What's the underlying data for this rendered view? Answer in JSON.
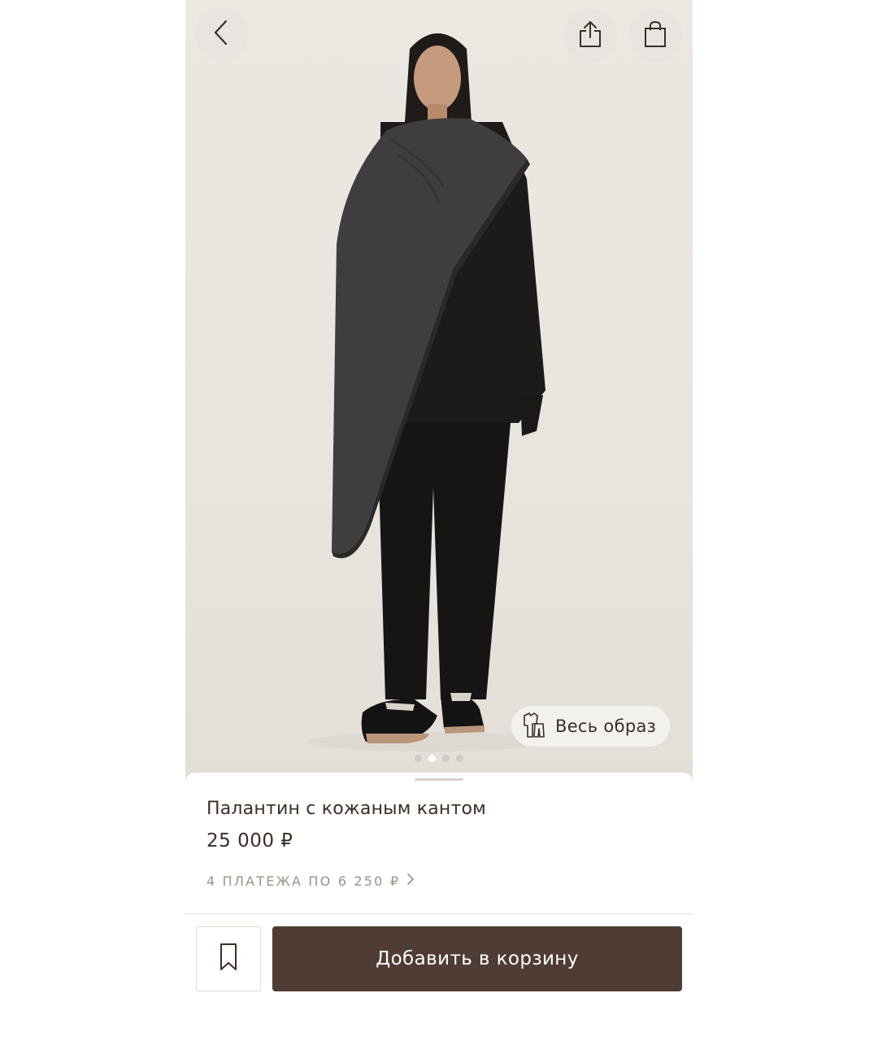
{
  "product": {
    "title": "Палантин с кожаным кантом",
    "price": "25 000 ₽",
    "installments": "4 ПЛАТЕЖА ПО 6 250 ₽"
  },
  "gallery": {
    "look_label": "Весь образ",
    "image_count": 4,
    "active_index": 1
  },
  "actions": {
    "add_to_cart": "Добавить в корзину"
  },
  "icons": {
    "back": "chevron-left-icon",
    "share": "share-icon",
    "bag": "shopping-bag-icon",
    "look": "outfit-icon",
    "favorite": "bookmark-icon",
    "installments": "chevron-right-icon"
  },
  "colors": {
    "accent": "#4e3c35",
    "text": "#3a2e29",
    "muted": "#9a928b",
    "background": "#ebe7e1"
  }
}
